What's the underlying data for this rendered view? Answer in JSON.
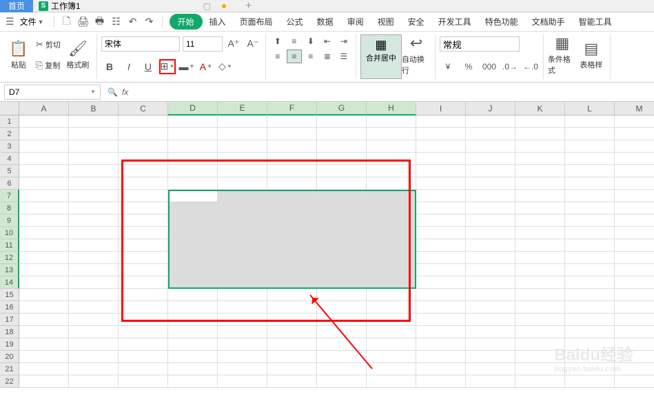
{
  "tabs": {
    "home": "首页",
    "workbook": "工作簿1",
    "workbook_icon": "S"
  },
  "menu": {
    "file": "文件",
    "items": [
      "开始",
      "插入",
      "页面布局",
      "公式",
      "数据",
      "审阅",
      "视图",
      "安全",
      "开发工具",
      "特色功能",
      "文档助手",
      "智能工具"
    ]
  },
  "ribbon": {
    "paste": "粘贴",
    "cut": "剪切",
    "copy": "复制",
    "format_painter": "格式刷",
    "font_name": "宋体",
    "font_size": "11",
    "merge": "合并居中",
    "wrap": "自动换行",
    "number_format": "常规",
    "cond_format": "条件格式",
    "table_style": "表格样"
  },
  "name_box": "D7",
  "columns": [
    "A",
    "B",
    "C",
    "D",
    "E",
    "F",
    "G",
    "H",
    "I",
    "J",
    "K",
    "L",
    "M"
  ],
  "rows": [
    "1",
    "2",
    "3",
    "4",
    "5",
    "6",
    "7",
    "8",
    "9",
    "10",
    "11",
    "12",
    "13",
    "14",
    "15",
    "16",
    "17",
    "18",
    "19",
    "20",
    "21",
    "22"
  ],
  "selected_cols": [
    "D",
    "E",
    "F",
    "G",
    "H"
  ],
  "selected_rows": [
    "7",
    "8",
    "9",
    "10",
    "11",
    "12",
    "13",
    "14"
  ],
  "watermark": {
    "main": "Baidu经验",
    "sub": "jingyan.baidu.com"
  }
}
